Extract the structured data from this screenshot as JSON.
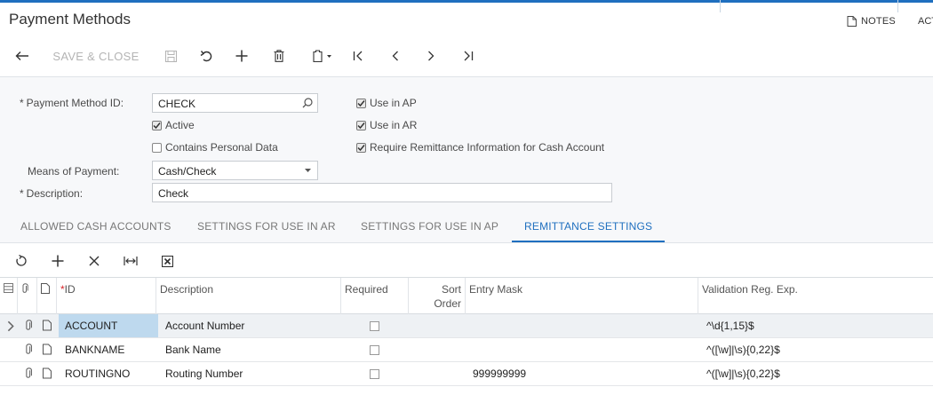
{
  "header": {
    "title": "Payment Methods",
    "notes_label": "NOTES",
    "actions_label_cut": "ACTIONS"
  },
  "toolbar": {
    "save_close_label": "SAVE & CLOSE"
  },
  "form": {
    "payment_method_id": {
      "label": "Payment Method ID:",
      "value": "CHECK"
    },
    "active": {
      "label": "Active",
      "checked": true
    },
    "contains_personal_data": {
      "label": "Contains Personal Data",
      "checked": false
    },
    "means_of_payment": {
      "label": "Means of Payment:",
      "value": "Cash/Check"
    },
    "description": {
      "label": "Description:",
      "value": "Check"
    },
    "use_in_ap": {
      "label": "Use in AP",
      "checked": true
    },
    "use_in_ar": {
      "label": "Use in AR",
      "checked": true
    },
    "require_remittance": {
      "label": "Require Remittance Information for Cash Account",
      "checked": true
    },
    "required_marker": "*"
  },
  "tabs": [
    {
      "label": "ALLOWED CASH ACCOUNTS",
      "active": false
    },
    {
      "label": "SETTINGS FOR USE IN AR",
      "active": false
    },
    {
      "label": "SETTINGS FOR USE IN AP",
      "active": false
    },
    {
      "label": "REMITTANCE SETTINGS",
      "active": true
    }
  ],
  "grid": {
    "columns": {
      "id": "ID",
      "id_required_marker": "*",
      "description": "Description",
      "required": "Required",
      "sort_order_line1": "Sort",
      "sort_order_line2": "Order",
      "entry_mask": "Entry Mask",
      "validation": "Validation Reg. Exp."
    },
    "rows": [
      {
        "id": "ACCOUNT",
        "description": "Account Number",
        "required": false,
        "sort_order": "",
        "entry_mask": "",
        "validation": "^\\d{1,15}$"
      },
      {
        "id": "BANKNAME",
        "description": "Bank Name",
        "required": false,
        "sort_order": "",
        "entry_mask": "",
        "validation": "^([\\w]|\\s){0,22}$"
      },
      {
        "id": "ROUTINGNO",
        "description": "Routing Number",
        "required": false,
        "sort_order": "",
        "entry_mask": "999999999",
        "validation": "^([\\w]|\\s){0,22}$"
      }
    ]
  },
  "colors": {
    "accent": "#1f6fbf",
    "selected_cell": "#bed9ee",
    "form_bg": "#f7f8fa"
  }
}
